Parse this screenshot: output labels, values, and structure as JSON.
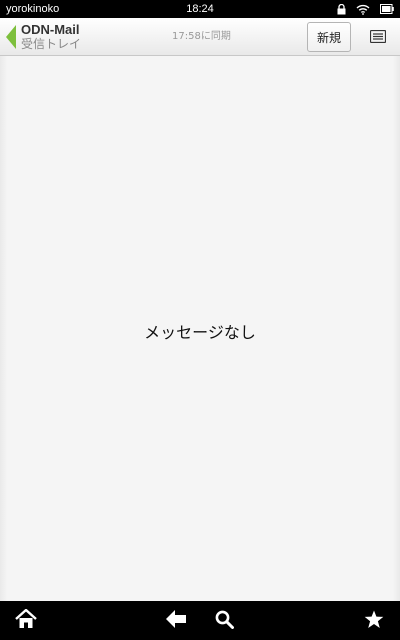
{
  "status_bar": {
    "user": "yorokinoko",
    "time": "18:24",
    "icons": [
      "lock-icon",
      "wifi-icon",
      "battery-icon"
    ]
  },
  "header": {
    "app_title": "ODN-Mail",
    "folder": "受信トレイ",
    "sync_status": "17:58に同期",
    "new_button_label": "新規",
    "accent_color": "#7dbf3c"
  },
  "main": {
    "empty_message": "メッセージなし"
  },
  "nav_bar": {
    "icons": [
      "home-icon",
      "back-arrow-icon",
      "search-icon",
      "star-icon"
    ]
  }
}
